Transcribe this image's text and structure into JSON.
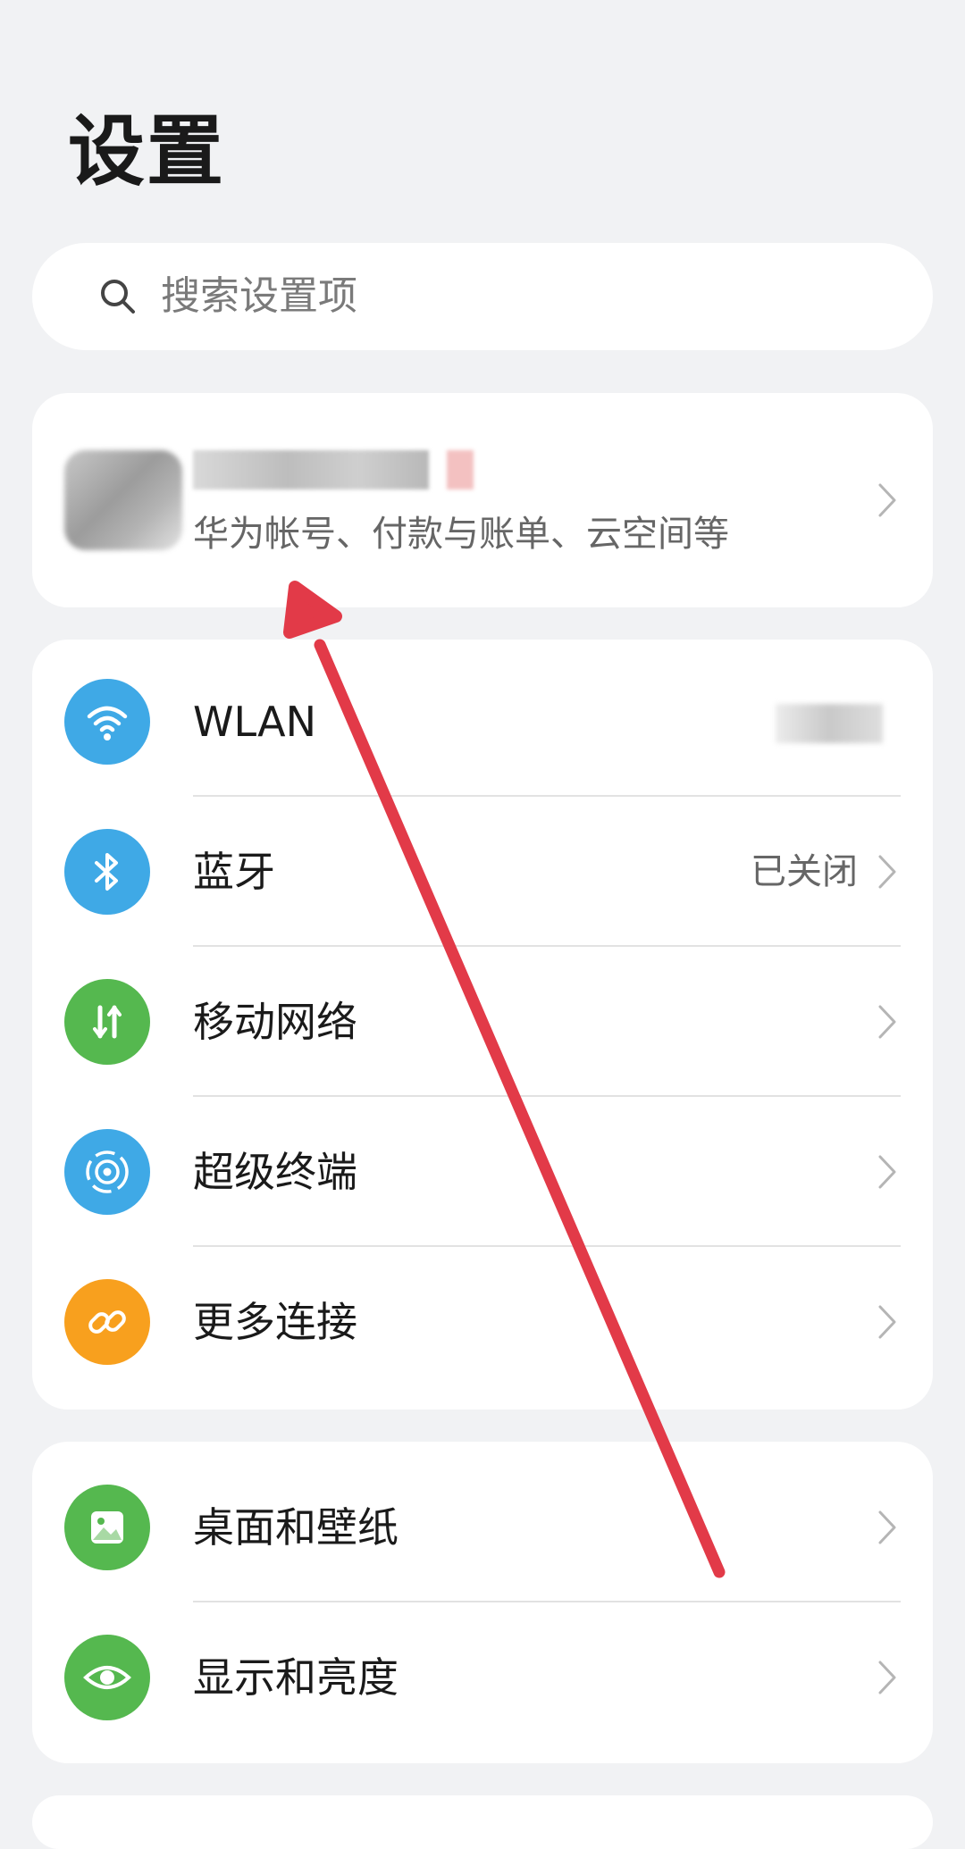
{
  "header": {
    "title": "设置"
  },
  "search": {
    "placeholder": "搜索设置项"
  },
  "account": {
    "subtitle": "华为帐号、付款与账单、云空间等"
  },
  "connectivity": [
    {
      "label": "WLAN",
      "value": "",
      "icon": "wifi-icon",
      "color": "#3fa9e6"
    },
    {
      "label": "蓝牙",
      "value": "已关闭",
      "icon": "bluetooth-icon",
      "color": "#3fa9e6"
    },
    {
      "label": "移动网络",
      "value": "",
      "icon": "mobile-data-icon",
      "color": "#55b84f"
    },
    {
      "label": "超级终端",
      "value": "",
      "icon": "super-device-icon",
      "color": "#3fa9e6"
    },
    {
      "label": "更多连接",
      "value": "",
      "icon": "link-icon",
      "color": "#f8a01e"
    }
  ],
  "display": [
    {
      "label": "桌面和壁纸",
      "icon": "wallpaper-icon",
      "color": "#55b84f"
    },
    {
      "label": "显示和亮度",
      "icon": "eye-icon",
      "color": "#55b84f"
    }
  ],
  "annotation": {
    "color": "#e23a48"
  }
}
